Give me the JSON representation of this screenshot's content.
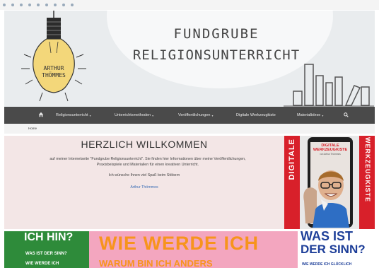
{
  "site": {
    "title_line1": "FUNDGRUBE",
    "title_line2": "RELIGIONSUNTERRICHT",
    "bulb_text_line1": "ARTHUR",
    "bulb_text_line2": "THÖMMES"
  },
  "nav": {
    "home_icon": "home-icon",
    "items": [
      {
        "label": "Religionsunterricht",
        "caret": "▾"
      },
      {
        "label": "Unterrichtsmethoden",
        "caret": "▾"
      },
      {
        "label": "Veröffentlichungen",
        "caret": "▾"
      },
      {
        "label": "Digitale Werkzeugkiste",
        "caret": ""
      },
      {
        "label": "Materialbörse",
        "caret": "▾"
      }
    ],
    "search_icon": "search-icon"
  },
  "breadcrumb": {
    "current": "Home"
  },
  "welcome": {
    "heading": "HERZLICH WILLKOMMEN",
    "intro": "auf meiner Internetseite \"Fundgrube Religionsunterricht\". Sie finden hier Informationen über meine Veröffentlichungen, Praxisbeispiele und Materialien für einen kreativen Unterricht.",
    "wish": "Ich wünsche Ihnen viel Spaß beim Stöbern",
    "author": "Arthur Thömmes"
  },
  "promo": {
    "left_vertical": "DIGITALE",
    "right_vertical": "WERKZEUGKISTE",
    "screen_title_line1": "DIGITALE",
    "screen_title_line2": "WERKZEUGKISTE",
    "screen_subtitle": "von Arthur Thömmes"
  },
  "banner": {
    "green_big": "ICH HIN?",
    "green_small1": "WAS IST DER SINN?",
    "green_small2": "WIE WERDE ICH",
    "pink_big": "WIE WERDE ICH",
    "pink_sub": "WARUM BIN ICH ANDERS",
    "white_t1": "WAS IST",
    "white_t2": "DER SINN?",
    "white_t3": "WIE WERDE ICH GLÜCKLICH"
  },
  "colors": {
    "nav_bg": "#4a4a4a",
    "promo_red": "#d8202a",
    "link_blue": "#3a6db5",
    "banner_orange": "#f7941d",
    "banner_green": "#2e8b3a",
    "banner_blue": "#1e3f99"
  }
}
